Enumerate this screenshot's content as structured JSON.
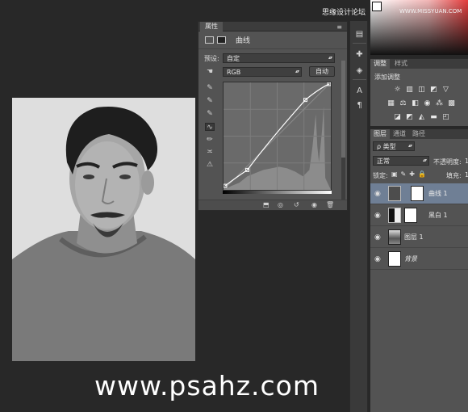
{
  "watermark": "www.psahz.com",
  "site_watermark": "思缘设计论坛",
  "site_watermark2": "WWW.MISSYUAN.COM",
  "properties": {
    "tab": "属性",
    "menu_icon": "≡",
    "title": "曲线",
    "preset_label": "预设:",
    "preset_value": "自定",
    "channel_value": "RGB",
    "auto_button": "自动"
  },
  "adjustments": {
    "tab_active": "调整",
    "tab_other": "样式",
    "add_label": "添加调整"
  },
  "layers_panel": {
    "tabs": [
      "图层",
      "通道",
      "路径"
    ],
    "filter_kind": "ρ 类型",
    "blend_mode": "正常",
    "opacity_label": "不透明度:",
    "opacity_value": "1",
    "lock_label": "锁定:",
    "fill_label": "填充:",
    "fill_value": "1",
    "layers": [
      {
        "name": "曲线 1",
        "type": "curves-adjustment",
        "selected": true
      },
      {
        "name": "黑白 1",
        "type": "black-white-adjustment",
        "selected": false
      },
      {
        "name": "图层 1",
        "type": "photo",
        "selected": false
      },
      {
        "name": "背景",
        "type": "background",
        "selected": false
      }
    ]
  },
  "icons": {
    "eye": "eye-icon",
    "curve_tool": "curve-tool-icon",
    "pencil_tool": "pencil-tool-icon",
    "eyedropper": "eyedropper-icon"
  },
  "colors": {
    "panel_bg": "#535353",
    "selected_layer": "#6f7f95",
    "canvas_bg": "#282828"
  }
}
